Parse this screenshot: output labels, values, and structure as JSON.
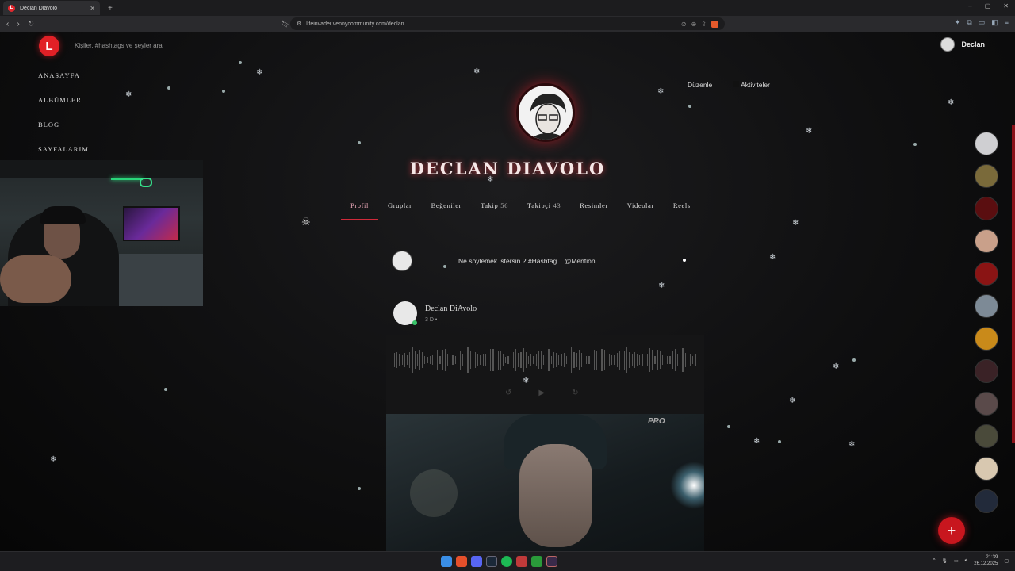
{
  "browser": {
    "tab_title": "Declan Diavolo",
    "tab_favicon": "L",
    "new_tab": "+",
    "url": "lifeinvader.vennycommunity.com/declan",
    "window_controls": [
      "–",
      "▢",
      "✕"
    ]
  },
  "header": {
    "logo_letter": "L",
    "search_placeholder": "Kişiler, #hashtags ve şeyler ara",
    "user_name": "Declan"
  },
  "sidebar": {
    "items": [
      {
        "label": "Anasayfa"
      },
      {
        "label": "Albümler"
      },
      {
        "label": "Blog"
      },
      {
        "label": "Sayfalarım"
      }
    ]
  },
  "profile": {
    "name": "DECLAN DIAVOLO",
    "edit_label": "Düzenle",
    "activities_label": "Aktiviteler",
    "tabs": [
      {
        "label": "Profil",
        "count": "",
        "active": true
      },
      {
        "label": "Gruplar",
        "count": ""
      },
      {
        "label": "Beğeniler",
        "count": ""
      },
      {
        "label": "Takip",
        "count": "56"
      },
      {
        "label": "Takipçi",
        "count": "43"
      },
      {
        "label": "Resimler",
        "count": ""
      },
      {
        "label": "Videolar",
        "count": ""
      },
      {
        "label": "Reels",
        "count": ""
      }
    ]
  },
  "composer": {
    "placeholder": "Ne söylemek istersin ? #Hashtag .. @Mention.."
  },
  "post": {
    "author": "Declan DiAvolo",
    "time": "3 D •",
    "media_sign": "PRO"
  },
  "taskbar": {
    "time": "21:39",
    "date": "26.12.2025"
  },
  "colors": {
    "accent": "#e12026",
    "background": "#0b0b0c"
  }
}
